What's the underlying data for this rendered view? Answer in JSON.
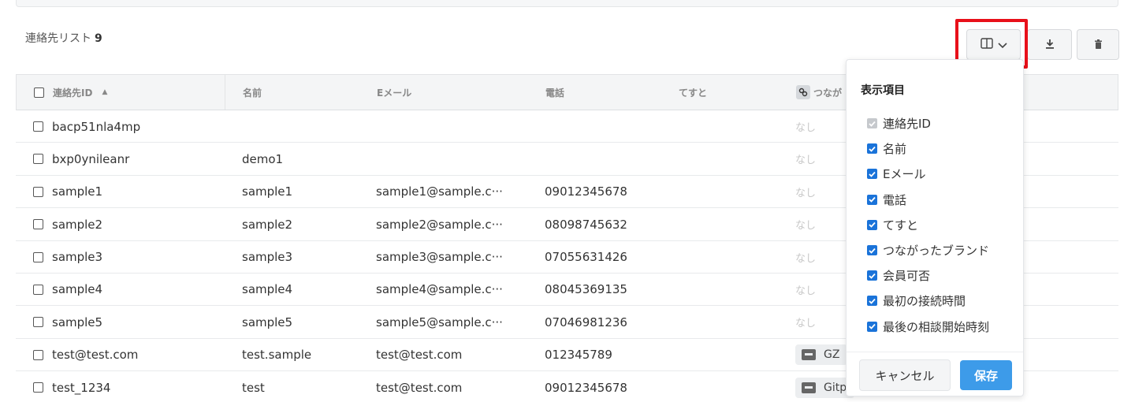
{
  "list": {
    "title": "連絡先リスト",
    "count": "9"
  },
  "toolbar": {
    "columns_icon": "columns-icon",
    "chevron_icon": "chevron-down-icon",
    "download_icon": "download-icon",
    "delete_icon": "trash-icon"
  },
  "table": {
    "headers": [
      "連絡先ID",
      "名前",
      "Eメール",
      "電話",
      "てすと",
      "つなが"
    ],
    "rows": [
      {
        "id": "bacp51nla4mp",
        "name": "",
        "email": "",
        "phone": "",
        "test": "",
        "brand": "なし",
        "brand_type": "none"
      },
      {
        "id": "bxp0ynileanr",
        "name": "demo1",
        "email": "",
        "phone": "",
        "test": "",
        "brand": "なし",
        "brand_type": "none"
      },
      {
        "id": "sample1",
        "name": "sample1",
        "email": "sample1@sample.c···",
        "phone": "09012345678",
        "test": "",
        "brand": "なし",
        "brand_type": "none"
      },
      {
        "id": "sample2",
        "name": "sample2",
        "email": "sample2@sample.c···",
        "phone": "08098745632",
        "test": "",
        "brand": "なし",
        "brand_type": "none"
      },
      {
        "id": "sample3",
        "name": "sample3",
        "email": "sample3@sample.c···",
        "phone": "07055631426",
        "test": "",
        "brand": "なし",
        "brand_type": "none"
      },
      {
        "id": "sample4",
        "name": "sample4",
        "email": "sample4@sample.c···",
        "phone": "08045369135",
        "test": "",
        "brand": "なし",
        "brand_type": "none"
      },
      {
        "id": "sample5",
        "name": "sample5",
        "email": "sample5@sample.c···",
        "phone": "07046981236",
        "test": "",
        "brand": "なし",
        "brand_type": "none"
      },
      {
        "id": "test@test.com",
        "name": "test.sample",
        "email": "test@test.com",
        "phone": "012345789",
        "test": "",
        "brand": "GZ",
        "brand_type": "badge"
      },
      {
        "id": "test_1234",
        "name": "test",
        "email": "test@test.com",
        "phone": "09012345678",
        "test": "",
        "brand": "Gitp",
        "brand_type": "badge"
      }
    ]
  },
  "popover": {
    "title": "表示項目",
    "items": [
      {
        "label": "連絡先ID",
        "checked": true,
        "disabled": true
      },
      {
        "label": "名前",
        "checked": true,
        "disabled": false
      },
      {
        "label": "Eメール",
        "checked": true,
        "disabled": false
      },
      {
        "label": "電話",
        "checked": true,
        "disabled": false
      },
      {
        "label": "てすと",
        "checked": true,
        "disabled": false
      },
      {
        "label": "つながったブランド",
        "checked": true,
        "disabled": false
      },
      {
        "label": "会員可否",
        "checked": true,
        "disabled": false
      },
      {
        "label": "最初の接続時間",
        "checked": true,
        "disabled": false
      },
      {
        "label": "最後の相談開始時刻",
        "checked": true,
        "disabled": false
      }
    ],
    "cancel_label": "キャンセル",
    "save_label": "保存"
  },
  "colors": {
    "accent": "#3d9be9",
    "checkbox": "#1a73d9",
    "highlight": "#e8101a"
  }
}
